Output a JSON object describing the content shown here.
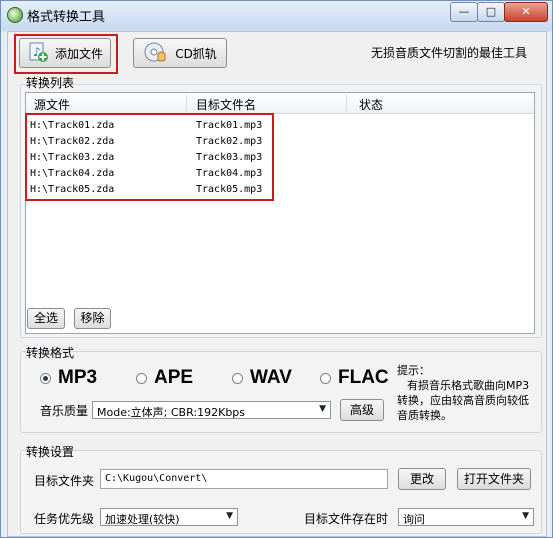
{
  "window": {
    "title": "格式转换工具",
    "min": "—",
    "max": "□",
    "close": "✕"
  },
  "toolbar": {
    "add_file": "添加文件",
    "cd_rip": "CD抓轨",
    "slogan": "无损音质文件切割的最佳工具"
  },
  "list_group": {
    "title": "转换列表",
    "columns": [
      "源文件",
      "目标文件名",
      "状态"
    ],
    "rows": [
      {
        "source": "H:\\Track01.zda",
        "target": "Track01.mp3"
      },
      {
        "source": "H:\\Track02.zda",
        "target": "Track02.mp3"
      },
      {
        "source": "H:\\Track03.zda",
        "target": "Track03.mp3"
      },
      {
        "source": "H:\\Track04.zda",
        "target": "Track04.mp3"
      },
      {
        "source": "H:\\Track05.zda",
        "target": "Track05.mp3"
      }
    ],
    "select_all": "全选",
    "remove": "移除"
  },
  "format_group": {
    "title": "转换格式",
    "formats": [
      "MP3",
      "APE",
      "WAV",
      "FLAC"
    ],
    "selected_format": "MP3",
    "quality_label": "音乐质量",
    "quality_value": "Mode:立体声; CBR:192Kbps",
    "advanced": "高级",
    "hint_lines": [
      "提示：",
      "有损音乐格式歌曲向MP3",
      "转换，应由较高音质向较低",
      "音质转换。"
    ]
  },
  "settings_group": {
    "title": "转换设置",
    "target_folder_label": "目标文件夹",
    "target_folder_value": "C:\\Kugou\\Convert\\",
    "change": "更改",
    "open_folder": "打开文件夹",
    "priority_label": "任务优先级",
    "priority_value": "加速处理(较快)",
    "exists_label": "目标文件存在时",
    "exists_value": "询问"
  },
  "colors": {
    "highlight_border": "#cc1b1b",
    "accent": "#6f8fb8"
  },
  "icons": [
    "app-icon",
    "add-file-icon",
    "cd-icon",
    "dropdown-arrow-icon"
  ]
}
